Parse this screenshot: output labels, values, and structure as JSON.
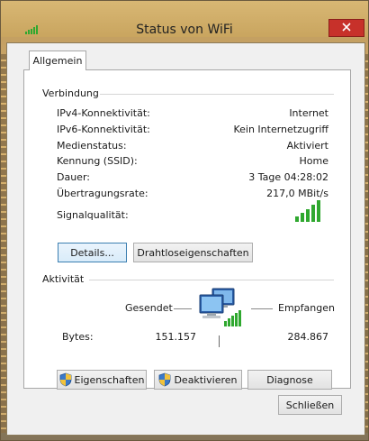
{
  "window": {
    "title": "Status von WiFi"
  },
  "tabs": [
    {
      "label": "Allgemein"
    }
  ],
  "connection": {
    "group_title": "Verbindung",
    "rows": [
      {
        "label": "IPv4-Konnektivität:",
        "value": "Internet"
      },
      {
        "label": "IPv6-Konnektivität:",
        "value": "Kein Internetzugriff"
      },
      {
        "label": "Medienstatus:",
        "value": "Aktiviert"
      },
      {
        "label": "Kennung (SSID):",
        "value": "Home"
      },
      {
        "label": "Dauer:",
        "value": "3 Tage 04:28:02"
      },
      {
        "label": "Übertragungsrate:",
        "value": "217,0 MBit/s"
      }
    ],
    "signal_label": "Signalqualität:",
    "signal_bars": 5,
    "details_button": "Details...",
    "wireless_props_button": "Drahtloseigenschaften"
  },
  "activity": {
    "group_title": "Aktivität",
    "sent_label": "Gesendet",
    "received_label": "Empfangen",
    "bytes_label": "Bytes:",
    "bytes_sent": "151.157",
    "bytes_received": "284.867"
  },
  "actions": {
    "properties_button": "Eigenschaften",
    "deactivate_button": "Deaktivieren",
    "diagnose_button": "Diagnose"
  },
  "footer": {
    "close_button": "Schließen"
  },
  "colors": {
    "signal_green": "#2fa82f",
    "close_red": "#c7312a",
    "focus_blue": "#3c7fb1"
  },
  "icons": [
    "wifi-signal-icon",
    "close-icon",
    "network-computers-icon",
    "uac-shield-icon"
  ]
}
